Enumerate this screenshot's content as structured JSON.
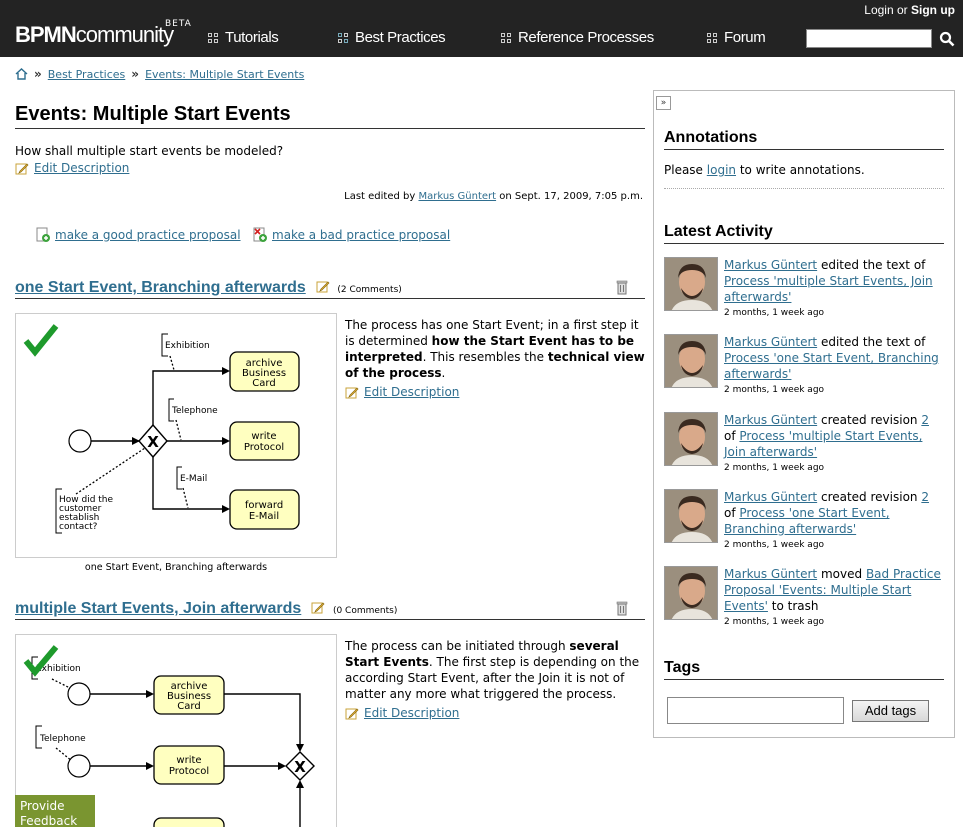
{
  "header": {
    "logo_bold": "BPMN",
    "logo_light": "community",
    "beta": "BETA",
    "login": "Login",
    "or": "or",
    "signup": "Sign up",
    "nav": [
      "Tutorials",
      "Best Practices",
      "Reference Processes",
      "Forum"
    ],
    "search_value": ""
  },
  "breadcrumb": {
    "home_icon": "home-icon",
    "items": [
      "Best Practices",
      "Events: Multiple Start Events"
    ],
    "separator": "»"
  },
  "page": {
    "title": "Events: Multiple Start Events",
    "question": "How shall multiple start events be modeled?",
    "edit_description": "Edit Description",
    "last_edited_prefix": "Last edited by",
    "last_edited_user": "Markus Güntert",
    "last_edited_suffix": "on Sept. 17, 2009, 7:05 p.m.",
    "good_proposal": "make a good practice proposal",
    "bad_proposal": "make a bad practice proposal"
  },
  "practices": [
    {
      "title": "one Start Event, Branching afterwards",
      "comments": "(2 Comments)",
      "caption": "one Start Event, Branching afterwards",
      "desc_parts": [
        "The process has one Start Event; in a first step it is determined ",
        "how the Start Event has to be interpreted",
        ". This resembles the ",
        "technical view of the process",
        "."
      ],
      "edit_description": "Edit Description",
      "diagram": {
        "labels": [
          "Exhibition",
          "Telephone",
          "E-Mail"
        ],
        "question_lines": [
          "How did the",
          "customer",
          "establish",
          "contact?"
        ],
        "tasks": [
          [
            "archive",
            "Business",
            "Card"
          ],
          [
            "write",
            "Protocol"
          ],
          [
            "forward",
            "E-Mail"
          ]
        ],
        "gateway": "X"
      }
    },
    {
      "title": "multiple Start Events, Join afterwards",
      "comments": "(0 Comments)",
      "desc_parts": [
        "The process can be initiated through ",
        "several Start Events",
        ". The first step is depending on the according Start Event, after the Join it is not of matter any more what triggered the process."
      ],
      "edit_description": "Edit Description",
      "diagram": {
        "labels": [
          "Exhibition",
          "Telephone"
        ],
        "tasks": [
          [
            "archive",
            "Business",
            "Card"
          ],
          [
            "write",
            "Protocol"
          ]
        ],
        "gateway": "X"
      }
    }
  ],
  "feedback": {
    "line1": "Provide",
    "line2": "Feedback"
  },
  "panel": {
    "collapse": "»",
    "annotations_title": "Annotations",
    "annot_prefix": "Please",
    "annot_link": "login",
    "annot_suffix": "to write annotations.",
    "activity_title": "Latest Activity",
    "activities": [
      {
        "user": "Markus Güntert",
        "action": "edited the text of",
        "rev": "",
        "rev_suffix": "",
        "target": "Process 'multiple Start Events, Join afterwards'",
        "tail": "",
        "time": "2 months, 1 week ago"
      },
      {
        "user": "Markus Güntert",
        "action": "edited the text of",
        "rev": "",
        "rev_suffix": "",
        "target": "Process 'one Start Event, Branching afterwards'",
        "tail": "",
        "time": "2 months, 1 week ago"
      },
      {
        "user": "Markus Güntert",
        "action": "created revision",
        "rev": "2",
        "rev_suffix": "of",
        "target": "Process 'multiple Start Events, Join afterwards'",
        "tail": "",
        "time": "2 months, 1 week ago"
      },
      {
        "user": "Markus Güntert",
        "action": "created revision",
        "rev": "2",
        "rev_suffix": "of",
        "target": "Process 'one Start Event, Branching afterwards'",
        "tail": "",
        "time": "2 months, 1 week ago"
      },
      {
        "user": "Markus Güntert",
        "action": "moved",
        "rev": "",
        "rev_suffix": "",
        "target": "Bad Practice Proposal 'Events: Multiple Start Events'",
        "tail": "to trash",
        "time": "2 months, 1 week ago"
      }
    ],
    "tags_title": "Tags",
    "tags_input": "",
    "add_tags": "Add tags"
  },
  "colors": {
    "header_bg": "#232323",
    "link": "#2f6e8f",
    "task_fill": "#ffffc0",
    "check": "#1e9a2c",
    "feedback_bg": "#7a9530"
  }
}
